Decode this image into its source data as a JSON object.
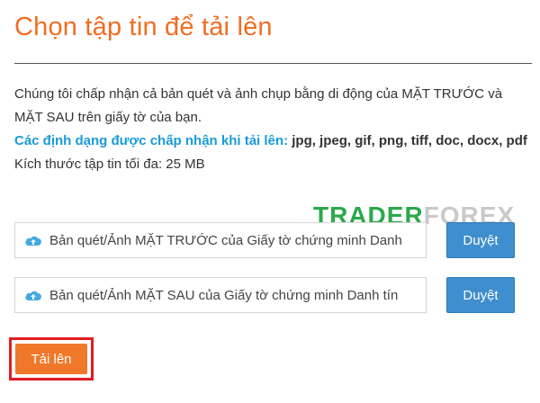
{
  "title": "Chọn tập tin để tải lên",
  "description": "Chúng tôi chấp nhận cả bản quét và ảnh chụp bằng di động của MẶT TRƯỚC và MẶT SAU trên giấy tờ của bạn.",
  "formats": {
    "label": "Các định dạng được chấp nhận khi tải lên:",
    "value": "jpg, jpeg, gif, png, tiff, doc, docx, pdf"
  },
  "max_size": "Kích thước tập tin tối đa: 25 MB",
  "file_inputs": [
    {
      "text": "Bản quét/Ảnh MẶT TRƯỚC của Giấy tờ chứng minh Danh",
      "icon": "cloud-upload-icon",
      "button": "Duyệt"
    },
    {
      "text": "Bản quét/Ảnh MẶT SAU của Giấy tờ chứng minh Danh tín",
      "icon": "cloud-upload-icon",
      "button": "Duyệt"
    }
  ],
  "upload_button": "Tải lên",
  "watermark": {
    "part1": "TRADER",
    "part2": "FOREX"
  },
  "colors": {
    "title": "#f26d21",
    "formats_label": "#1a9bd7",
    "browse_button": "#3f8ecd",
    "upload_button": "#f0782a",
    "highlight_border": "#e21b23"
  }
}
